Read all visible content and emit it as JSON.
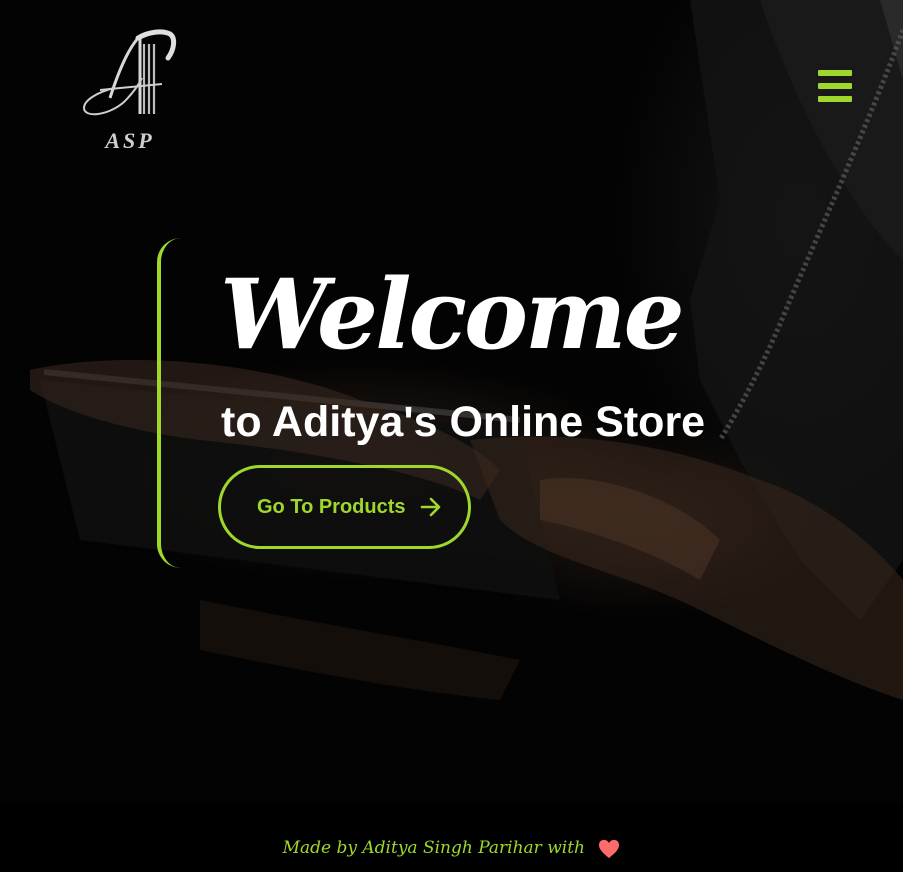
{
  "brand": {
    "logo_text": "ASP"
  },
  "hero": {
    "welcome": "Welcome",
    "subtitle": "to Aditya's Online Store",
    "cta_label": "Go To Products"
  },
  "footer": {
    "credit": "Made by Aditya Singh Parihar with"
  },
  "colors": {
    "accent": "#9fd82b",
    "background": "#000000",
    "heart": "#ff6b6b"
  },
  "icons": {
    "menu": "hamburger-menu-icon",
    "cta": "arrow-right-icon",
    "footer": "heart-icon"
  }
}
